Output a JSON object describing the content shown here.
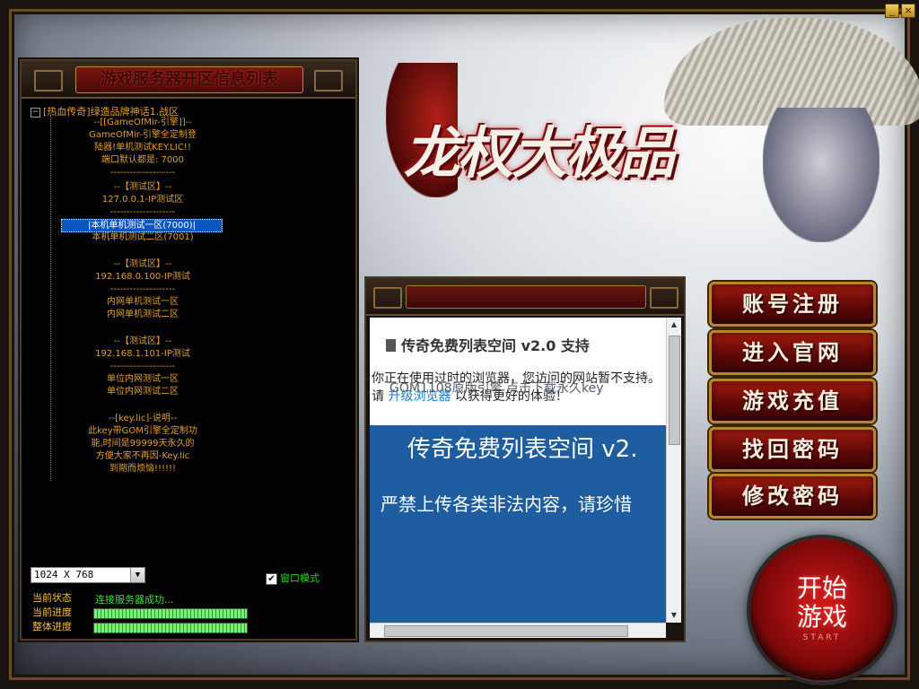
{
  "window": {
    "min_label": "_",
    "close_label": "×"
  },
  "server_panel": {
    "title": "游戏服务器开区信息列表",
    "root_label": "[热血传奇]绿造品牌神话1.战区",
    "toggle": "−",
    "items": [
      {
        "text": "--[[GameOfMir-引擎]]--"
      },
      {
        "text": "GameOfMir-引擎全定制登"
      },
      {
        "text": "陆器!单机测试KEY.LIC!!"
      },
      {
        "text": "端口默认都是: 7000"
      },
      {
        "text": "--------------------"
      },
      {
        "text": "--【测试区】--"
      },
      {
        "text": "127.0.0.1-IP测试区"
      },
      {
        "text": "--------------------"
      },
      {
        "text": "|本机单机测试一区(7000)|"
      },
      {
        "text": "本机单机测试二区(7001)"
      },
      {
        "text": "--【测试区】--"
      },
      {
        "text": "192.168.0.100-IP测试"
      },
      {
        "text": "--------------------"
      },
      {
        "text": "内网单机测试一区"
      },
      {
        "text": "内网单机测试二区"
      },
      {
        "text": "--【测试区】--"
      },
      {
        "text": "192.168.1.101-IP测试"
      },
      {
        "text": "--------------------"
      },
      {
        "text": "单位内网测试一区"
      },
      {
        "text": "单位内网测试二区"
      },
      {
        "text": "--[key.lic]-说明--"
      },
      {
        "text": "此key带GOM引擎全定制功"
      },
      {
        "text": "能,时间是99999天永久的"
      },
      {
        "text": "方便大家不再因-Key.lic"
      },
      {
        "text": "到期而烦恼!!!!!!"
      }
    ],
    "resolution": "1024 X 768",
    "resolution_arrow": "▼",
    "window_mode_label": "窗口模式",
    "window_mode_check": "✔",
    "status": {
      "state_label": "当前状态",
      "progress_label": "当前进度",
      "total_label": "整体进度",
      "state_text": "连接服务器成功...",
      "current_progress": 1.0,
      "total_progress": 1.0
    }
  },
  "logo": {
    "text": "龙权大极品"
  },
  "news": {
    "title": "传奇免费列表空间 v2.0 支持",
    "warning_1": "你正在使用过时的浏览器，您访问的网站暂不支持。请",
    "warning_link": "升级浏览器",
    "warning_2": "以获得更好的体验！",
    "overlay": "GOM1108原版引擎 点击下载永久key",
    "banner_title": "传奇免费列表空间 v2.",
    "banner_sub": "严禁上传各类非法内容，请珍惜",
    "scroll_up": "▲",
    "scroll_down": "▼"
  },
  "menu": {
    "register": "账号注册",
    "website": "进入官网",
    "recharge": "游戏充值",
    "recover": "找回密码",
    "change": "修改密码"
  },
  "start": {
    "label": "开始\n游戏",
    "label_1": "开始",
    "label_2": "游戏",
    "sub": "START"
  },
  "colors": {
    "accent_red": "#a01a10",
    "gold": "#b8862a",
    "tree_text": "#e0a030",
    "status_green": "#40e040"
  }
}
